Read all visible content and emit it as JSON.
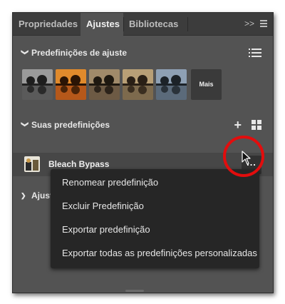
{
  "tabs": [
    {
      "label": "Propriedades"
    },
    {
      "label": "Ajustes"
    },
    {
      "label": "Bibliotecas"
    }
  ],
  "tabbar": {
    "overflow_label": ">>"
  },
  "presets_section": {
    "title": "Predefinições de ajuste",
    "more_label": "Mais"
  },
  "your_presets": {
    "title": "Suas predefinições",
    "item_label": "Bleach Bypass",
    "more_dots": "..."
  },
  "adjust_section": {
    "title": "Ajust"
  },
  "context_menu": {
    "items": [
      "Renomear predefinição",
      "Excluir Predefinição",
      "Exportar predefinição",
      "Exportar todas as predefinições personalizadas"
    ]
  },
  "colors": {
    "panel": "#535353",
    "tabbar": "#3c3c3c",
    "menu": "#262626",
    "highlight_ring": "#e20d0d"
  }
}
